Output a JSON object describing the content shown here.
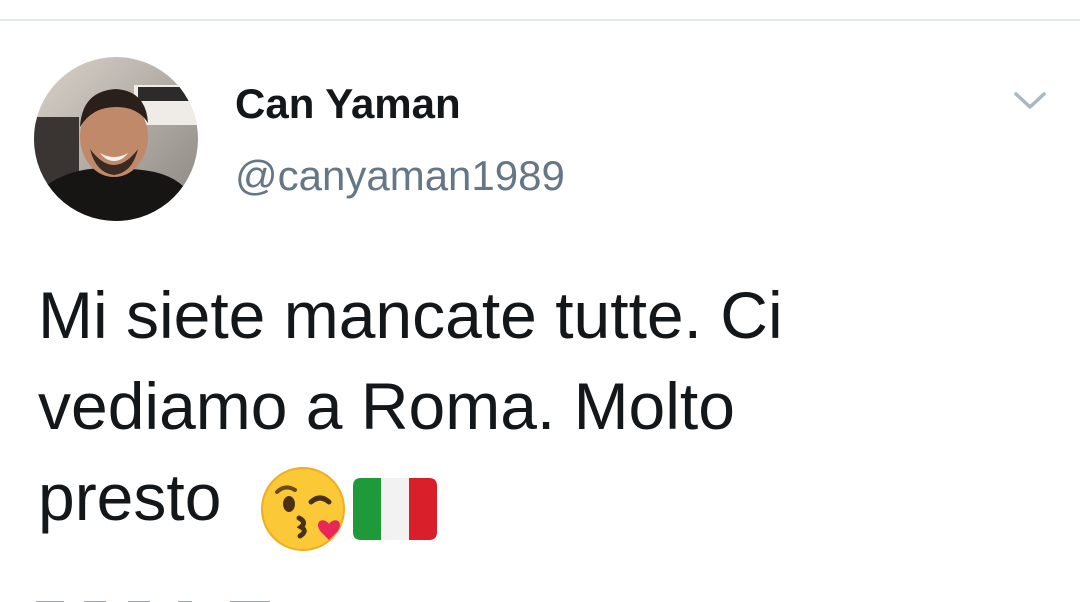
{
  "tweet": {
    "author": {
      "display_name": "Can Yaman",
      "handle": "@canyaman1989"
    },
    "text_lines": [
      "Mi siete mancate tutte. Ci",
      "vediamo a Roma. Molto",
      "presto"
    ],
    "emojis": [
      "face-throwing-kiss-icon",
      "italy-flag-icon"
    ]
  },
  "colors": {
    "text_primary": "#14171a",
    "text_secondary": "#657786",
    "divider": "#e1e8ed",
    "caret": "#aab8c2"
  }
}
